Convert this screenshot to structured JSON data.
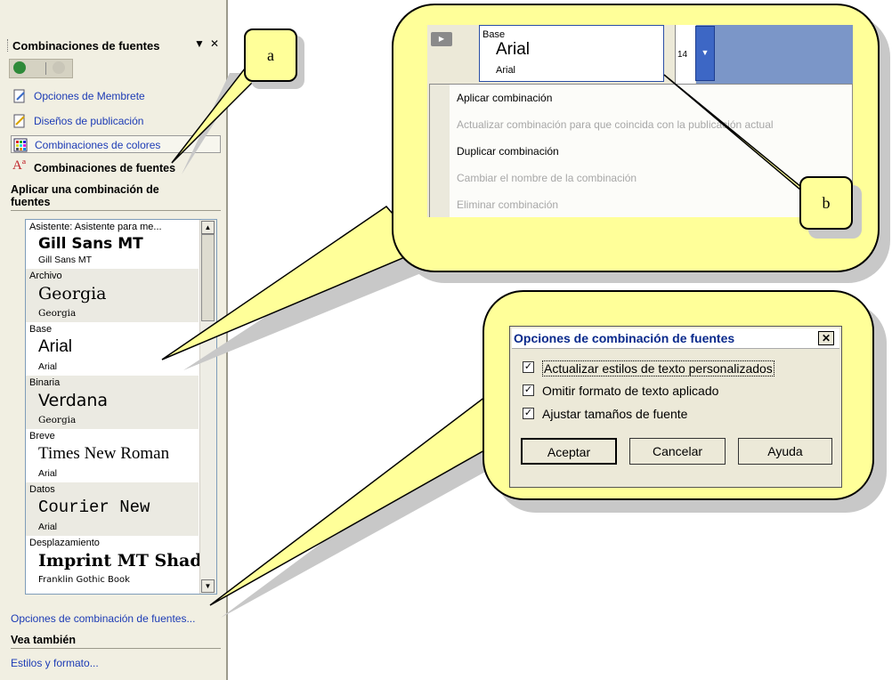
{
  "task_pane": {
    "title": "Combinaciones de fuentes",
    "dropdown_glyph": "▼",
    "close_glyph": "✕",
    "links": [
      {
        "label": "Opciones de Membrete",
        "icon": "letterhead-icon"
      },
      {
        "label": "Diseños de publicación",
        "icon": "publication-design-icon"
      },
      {
        "label": "Combinaciones de colores",
        "icon": "color-scheme-icon"
      }
    ],
    "current_section": {
      "icon_text": "Aª",
      "label": "Combinaciones de fuentes"
    },
    "apply_heading": "Aplicar una combinación de fuentes",
    "font_schemes": [
      {
        "name": "Asistente: Asistente para me...",
        "heading": "Gill Sans MT",
        "body": "Gill Sans MT"
      },
      {
        "name": "Archivo",
        "heading": "Georgia",
        "body": "Georgia"
      },
      {
        "name": "Base",
        "heading": "Arial",
        "body": "Arial"
      },
      {
        "name": "Binaria",
        "heading": "Verdana",
        "body": "Georgia"
      },
      {
        "name": "Breve",
        "heading": "Times New Roman",
        "body": "Arial"
      },
      {
        "name": "Datos",
        "heading": "Courier New",
        "body": "Arial"
      },
      {
        "name": "Desplazamiento",
        "heading": "Imprint MT Shad...",
        "body": "Franklin Gothic Book"
      }
    ],
    "options_link": "Opciones de combinación de fuentes...",
    "see_also_heading": "Vea también",
    "styles_link": "Estilos y formato..."
  },
  "callout_labels": {
    "a": "a",
    "b": "b"
  },
  "top_screenshot": {
    "ruler_mark": "14",
    "combo": {
      "caption": "Base",
      "heading_font": "Arial",
      "body_font": "Arial"
    },
    "menu_items": [
      {
        "label": "Aplicar combinación",
        "enabled": true
      },
      {
        "label": "Actualizar combinación para que coincida con la publicación actual",
        "enabled": false
      },
      {
        "label": "Duplicar combinación",
        "enabled": true
      },
      {
        "label": "Cambiar el nombre de la combinación",
        "enabled": false
      },
      {
        "label": "Eliminar combinación",
        "enabled": false
      }
    ]
  },
  "dialog": {
    "title": "Opciones de combinación de fuentes",
    "close": "✕",
    "checkboxes": [
      {
        "label": "Actualizar estilos de texto personalizados",
        "checked": true
      },
      {
        "label": "Omitir formato de texto aplicado",
        "checked": true
      },
      {
        "label": "Ajustar tamaños de fuente",
        "checked": true
      }
    ],
    "buttons": {
      "ok": "Aceptar",
      "cancel": "Cancelar",
      "help": "Ayuda"
    }
  },
  "colors": {
    "callout_fill": "#ffff99",
    "link": "#1c3bb5",
    "pane_bg": "#f1efe2",
    "dialog_title": "#0a2a8c"
  }
}
